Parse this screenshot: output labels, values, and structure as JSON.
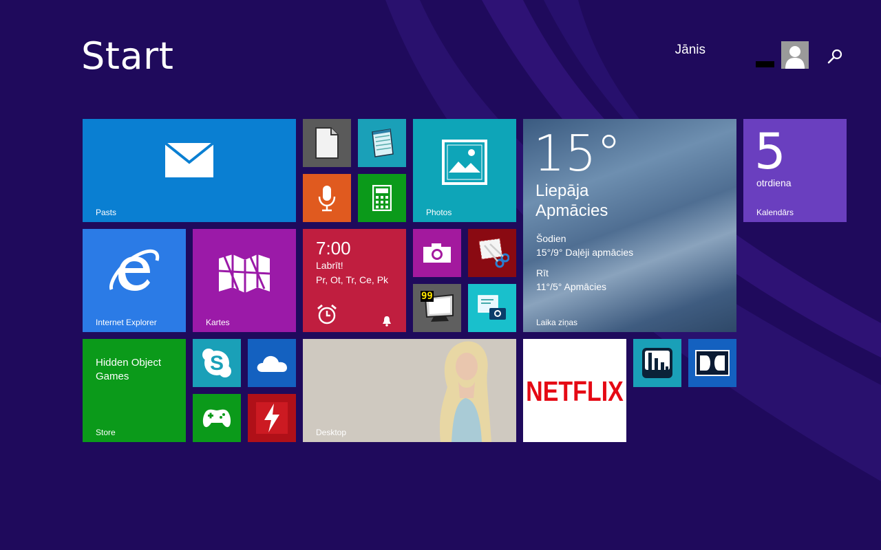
{
  "header": {
    "title": "Start",
    "user_name": "Jānis"
  },
  "colors": {
    "background": "#1f0a5c",
    "mail": "#0a7fd2",
    "ie": "#2b7be6",
    "maps": "#9b1aa8",
    "alarms": "#c01e3f",
    "photos": "#0ea5b8",
    "weather_sky": "#5a7898",
    "calendar": "#6a3fbf",
    "store": "#0b9a1a",
    "netflix_red": "#e50914"
  },
  "tiles": {
    "mail": {
      "label": "Pasts",
      "icon": "mail-icon"
    },
    "reader": {
      "label": "",
      "icon": "document-icon"
    },
    "notepad": {
      "label": "",
      "icon": "notepad-icon"
    },
    "sound_recorder": {
      "label": "",
      "icon": "microphone-icon"
    },
    "calculator": {
      "label": "",
      "icon": "calculator-icon"
    },
    "photos": {
      "label": "Photos",
      "icon": "photo-icon"
    },
    "weather": {
      "label": "Laika ziņas",
      "temp": "15°",
      "city": "Liepāja",
      "condition": "Apmācies",
      "today_label": "Šodien",
      "today_forecast": "15°/9° Daļēji apmācies",
      "tomorrow_label": "Rīt",
      "tomorrow_forecast": "11°/5° Apmācies"
    },
    "calendar": {
      "label": "Kalendārs",
      "day": "5",
      "weekday": "otrdiena"
    },
    "ie": {
      "label": "Internet Explorer",
      "icon": "ie-icon"
    },
    "maps": {
      "label": "Kartes",
      "icon": "map-icon"
    },
    "alarms": {
      "time": "7:00",
      "name": "Labrīt!",
      "days": "Pr, Ot, Tr, Ce, Pk",
      "icon": "alarm-clock-icon"
    },
    "camera": {
      "label": "",
      "icon": "camera-icon"
    },
    "snipping": {
      "label": "",
      "icon": "scissors-icon"
    },
    "monitor_app": {
      "label": "",
      "badge": "99",
      "icon": "monitor-icon"
    },
    "screenshot_app": {
      "label": "",
      "icon": "screenshot-icon"
    },
    "store": {
      "label": "Store",
      "text": "Hidden Object Games"
    },
    "skype": {
      "label": "",
      "icon": "skype-icon"
    },
    "onedrive": {
      "label": "",
      "icon": "cloud-icon"
    },
    "games": {
      "label": "",
      "icon": "gamepad-icon"
    },
    "flash": {
      "label": "",
      "icon": "lightning-icon"
    },
    "desktop": {
      "label": "Desktop"
    },
    "netflix": {
      "logo": "NETFLIX"
    },
    "equalizer": {
      "label": "",
      "icon": "equalizer-icon"
    },
    "dolby": {
      "label": "",
      "icon": "dolby-icon"
    }
  }
}
